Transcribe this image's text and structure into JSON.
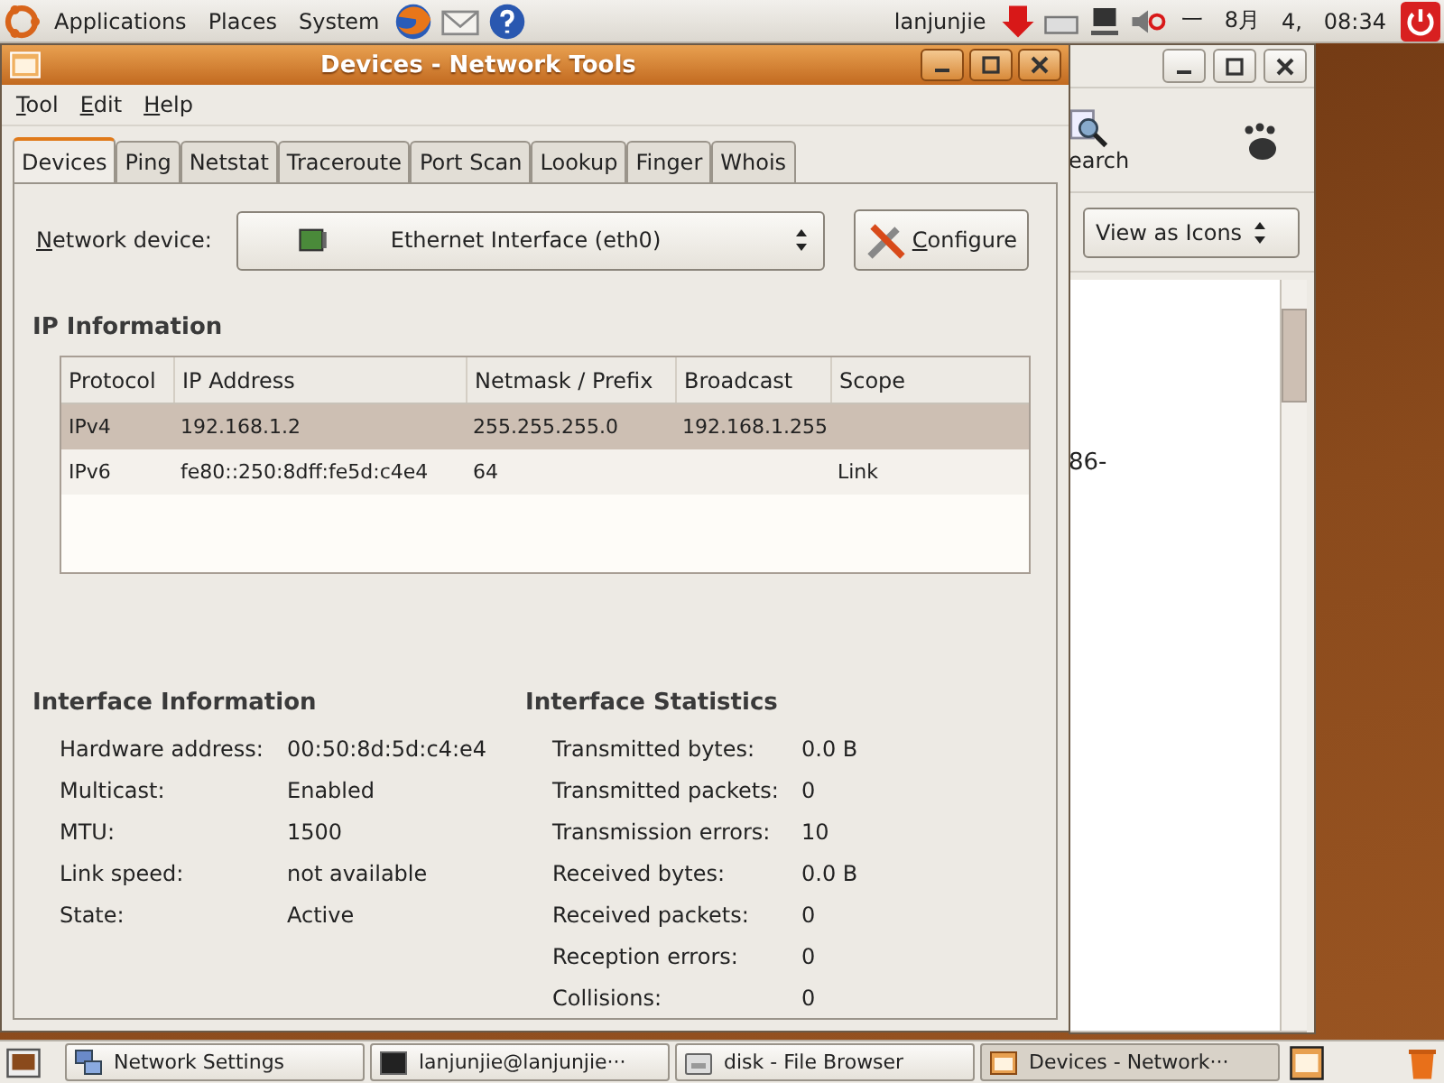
{
  "top_panel": {
    "menus": [
      "Applications",
      "Places",
      "System"
    ],
    "user": "lanjunjie",
    "clock_parts": [
      "一",
      "8月",
      "4,",
      "08:34"
    ]
  },
  "window": {
    "title": "Devices - Network Tools",
    "menu": [
      "Tool",
      "Edit",
      "Help"
    ]
  },
  "tabs": [
    {
      "label": "Devices",
      "selected": true
    },
    {
      "label": "Ping",
      "selected": false
    },
    {
      "label": "Netstat",
      "selected": false
    },
    {
      "label": "Traceroute",
      "selected": false
    },
    {
      "label": "Port Scan",
      "selected": false
    },
    {
      "label": "Lookup",
      "selected": false
    },
    {
      "label": "Finger",
      "selected": false
    },
    {
      "label": "Whois",
      "selected": false
    }
  ],
  "device": {
    "label": "Network device:",
    "value": "Ethernet Interface (eth0)",
    "button": "Configure"
  },
  "ip_information": {
    "title": "IP Information",
    "columns": [
      "Protocol",
      "IP Address",
      "Netmask / Prefix",
      "Broadcast",
      "Scope"
    ],
    "rows": [
      {
        "cells": [
          "IPv4",
          "192.168.1.2",
          "255.255.255.0",
          "192.168.1.255",
          ""
        ],
        "selected": true
      },
      {
        "cells": [
          "IPv6",
          "fe80::250:8dff:fe5d:c4e4",
          "64",
          "",
          "Link"
        ],
        "selected": false
      }
    ]
  },
  "interface_information": {
    "title": "Interface Information",
    "items": [
      {
        "label": "Hardware address:",
        "value": "00:50:8d:5d:c4:e4"
      },
      {
        "label": "Multicast:",
        "value": "Enabled"
      },
      {
        "label": "MTU:",
        "value": "1500"
      },
      {
        "label": "Link speed:",
        "value": "not available"
      },
      {
        "label": "State:",
        "value": "Active"
      }
    ]
  },
  "interface_statistics": {
    "title": "Interface Statistics",
    "items": [
      {
        "label": "Transmitted bytes:",
        "value": "0.0 B"
      },
      {
        "label": "Transmitted packets:",
        "value": "0"
      },
      {
        "label": "Transmission errors:",
        "value": "10"
      },
      {
        "label": "Received bytes:",
        "value": "0.0 B"
      },
      {
        "label": "Received packets:",
        "value": "0"
      },
      {
        "label": "Reception errors:",
        "value": "0"
      },
      {
        "label": "Collisions:",
        "value": "0"
      }
    ]
  },
  "file_browser": {
    "search_label": "earch",
    "view": "View as Icons",
    "fragment": "86-"
  },
  "taskbar": [
    {
      "label": "Network Settings",
      "kind": "network",
      "selected": false
    },
    {
      "label": "lanjunjie@lanjunjie···",
      "kind": "terminal",
      "selected": false
    },
    {
      "label": "disk - File Browser",
      "kind": "files",
      "selected": false
    },
    {
      "label": "Devices - Network···",
      "kind": "tools",
      "selected": true
    }
  ]
}
